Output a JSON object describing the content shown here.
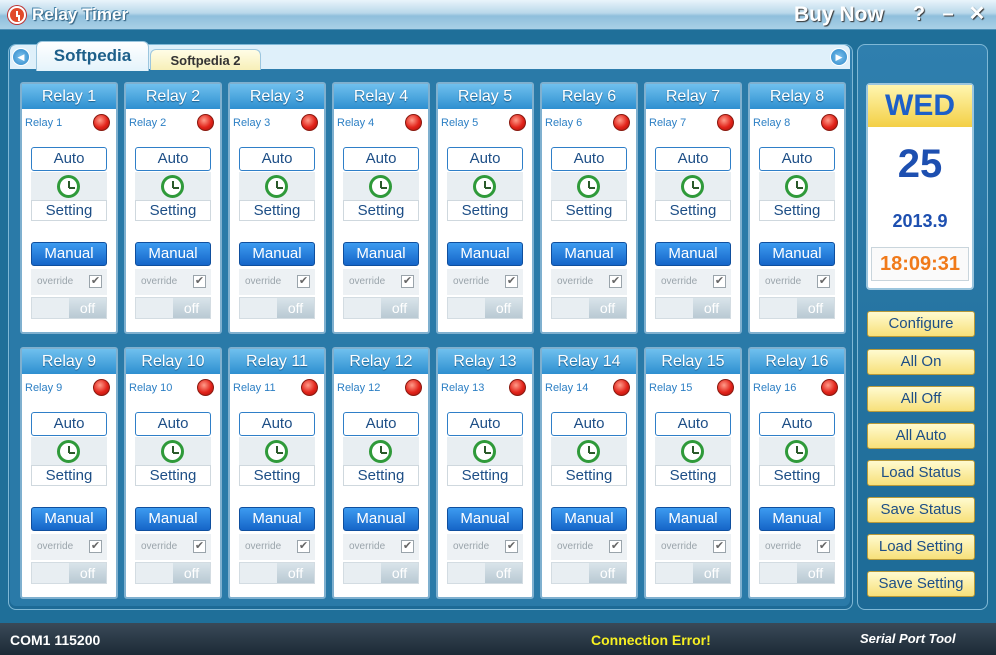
{
  "window": {
    "title": "Relay Timer",
    "buy_now": "Buy Now",
    "help": "?",
    "minimize": "–",
    "close": "✕"
  },
  "tabs": [
    {
      "label": "Softpedia",
      "active": true
    },
    {
      "label": "Softpedia 2",
      "active": false
    }
  ],
  "relays": [
    {
      "title": "Relay 1",
      "sub": "Relay 1"
    },
    {
      "title": "Relay 2",
      "sub": "Relay 2"
    },
    {
      "title": "Relay 3",
      "sub": "Relay 3"
    },
    {
      "title": "Relay 4",
      "sub": "Relay 4"
    },
    {
      "title": "Relay 5",
      "sub": "Relay 5"
    },
    {
      "title": "Relay 6",
      "sub": "Relay 6"
    },
    {
      "title": "Relay 7",
      "sub": "Relay 7"
    },
    {
      "title": "Relay 8",
      "sub": "Relay 8"
    },
    {
      "title": "Relay 9",
      "sub": "Relay 9"
    },
    {
      "title": "Relay 10",
      "sub": "Relay 10"
    },
    {
      "title": "Relay 11",
      "sub": "Relay 11"
    },
    {
      "title": "Relay 12",
      "sub": "Relay 12"
    },
    {
      "title": "Relay 13",
      "sub": "Relay 13"
    },
    {
      "title": "Relay 14",
      "sub": "Relay 14"
    },
    {
      "title": "Relay 15",
      "sub": "Relay 15"
    },
    {
      "title": "Relay 16",
      "sub": "Relay 16"
    }
  ],
  "relay_controls": {
    "auto_label": "Auto",
    "setting_label": "Setting",
    "manual_label": "Manual",
    "override_label": "override",
    "override_checked": "✔",
    "toggle_state": "off",
    "led_color": "#e2231a"
  },
  "date_panel": {
    "day": "WED",
    "date": "25",
    "year_month": "2013.9",
    "time": "18:09:31"
  },
  "side_buttons": [
    "Configure",
    "All On",
    "All Off",
    "All Auto",
    "Load Status",
    "Save Status",
    "Load Setting",
    "Save Setting"
  ],
  "status": {
    "port": "COM1 115200",
    "connection": "Connection Error!",
    "tool": "Serial Port Tool"
  },
  "icons": {
    "app": "alarm-clock-icon",
    "timer": "alarm-clock-icon",
    "nav_left": "arrow-left-icon",
    "nav_right": "arrow-right-icon"
  }
}
